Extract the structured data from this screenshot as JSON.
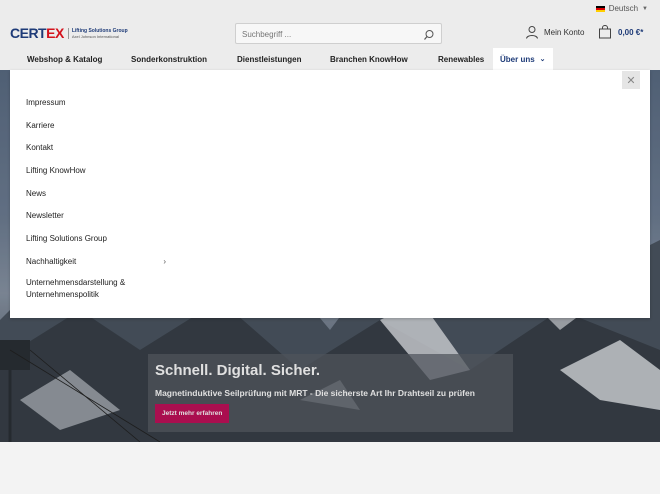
{
  "topbar": {
    "language": "Deutsch"
  },
  "header": {
    "logo": {
      "brand_a": "CERT",
      "brand_b": "EX",
      "tagline_1": "Lifting Solutions Group",
      "tagline_2": "Axel Johnson International"
    },
    "search": {
      "placeholder": "Suchbegriff ..."
    },
    "account_label": "Mein Konto",
    "cart_total": "0,00 €*"
  },
  "nav": {
    "items": [
      {
        "label": "Webshop & Katalog"
      },
      {
        "label": "Sonderkonstruktion"
      },
      {
        "label": "Dienstleistungen"
      },
      {
        "label": "Branchen KnowHow"
      },
      {
        "label": "Renewables"
      },
      {
        "label": "Über uns"
      }
    ]
  },
  "dropdown": {
    "close_icon": "close-icon",
    "items": [
      {
        "label": "Impressum"
      },
      {
        "label": "Karriere"
      },
      {
        "label": "Kontakt"
      },
      {
        "label": "Lifting KnowHow"
      },
      {
        "label": "News"
      },
      {
        "label": "Newsletter"
      },
      {
        "label": "Lifting Solutions Group"
      },
      {
        "label": "Nachhaltigkeit"
      },
      {
        "label": "Unternehmensdarstellung & Unternehmenspolitik"
      }
    ]
  },
  "hero": {
    "title": "Schnell. Digital. Sicher.",
    "subtitle": "Magnetinduktive Seilprüfung mit MRT - Die sicherste Art Ihr Drahtseil zu prüfen",
    "button_label": "Jetzt mehr erfahren"
  },
  "colors": {
    "brand_blue": "#1e3b78",
    "brand_red": "#d4131d",
    "cta": "#c2105a"
  }
}
